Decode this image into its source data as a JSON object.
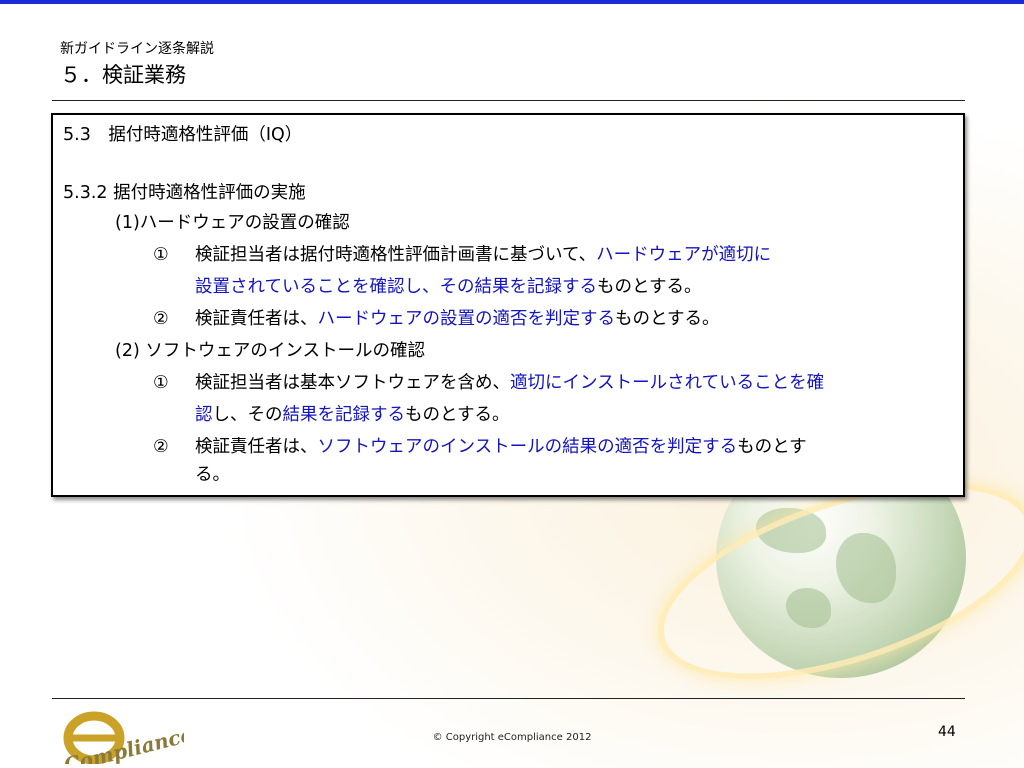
{
  "header": {
    "subtitle": "新ガイドライン逐条解説",
    "title": "５．検証業務"
  },
  "content": {
    "section": "5.3　据付時適格性評価（IQ）",
    "subsection": "5.3.2 据付時適格性評価の実施",
    "item1": {
      "heading": "(1)ハードウェアの設置の確認",
      "point1": {
        "marker": "①",
        "line1_plain": "検証担当者は据付時適格性評価計画書に基づいて、",
        "line1_blue": "ハードウェアが適切に",
        "line2_blue": "設置されていることを確認し、その結果を記録する",
        "line2_plain": "ものとする。"
      },
      "point2": {
        "marker": "②",
        "plain_a": "検証責任者は、",
        "blue": "ハードウェアの設置の適否を判定する",
        "plain_b": "ものとする。"
      }
    },
    "item2": {
      "heading": "(2) ソフトウェアのインストールの確認",
      "point1": {
        "marker": "①",
        "line1_plain": "検証担当者は基本ソフトウェアを含め、",
        "line1_blue": "適切にインストールされていることを確",
        "line2_blue_a": "認",
        "line2_plain_a": "し、その",
        "line2_blue_b": "結果を記録する",
        "line2_plain_b": "ものとする。"
      },
      "point2": {
        "marker": "②",
        "plain_a": "検証責任者は、",
        "blue": "ソフトウェアのインストールの結果の適否を判定する",
        "plain_b": "ものとす",
        "line2": "る。"
      }
    }
  },
  "footer": {
    "copyright": "© Copyright eCompliance 2012",
    "page_number": "44",
    "logo_letter": "e",
    "logo_text": "Compliance"
  },
  "colors": {
    "accent_rule": "#1a2bd6",
    "highlight_text": "#1313c0"
  }
}
